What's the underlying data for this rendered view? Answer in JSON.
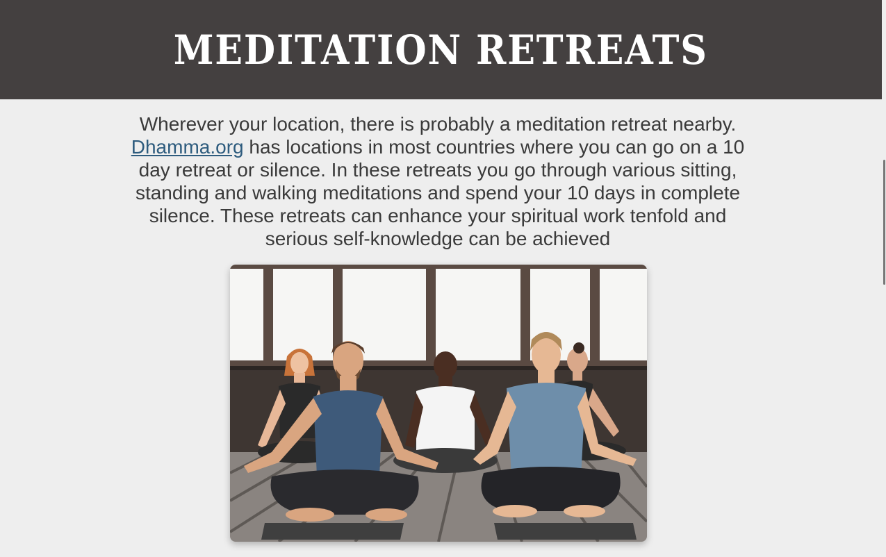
{
  "header": {
    "title": "MEDITATION RETREATS"
  },
  "intro": {
    "text_before_link": "Wherever your location, there is probably a meditation retreat nearby. ",
    "link_text": "Dhamma.org",
    "text_after_link": " has locations in most countries where you can go on a 10 day retreat or silence. In these retreats you go through various sitting, standing and walking meditations and spend your 10 days in complete silence. These retreats can enhance your spiritual work tenfold and serious self-knowledge can be achieved"
  },
  "colors": {
    "banner_background": "#444040",
    "page_background": "#eeeeee",
    "body_text": "#3a3a3a",
    "link": "#2e5c7e"
  },
  "image": {
    "icon": "photo-people-meditating"
  }
}
